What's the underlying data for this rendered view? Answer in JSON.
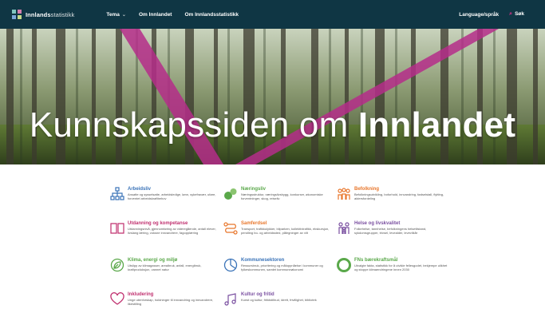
{
  "nav": {
    "logo_bold": "Innlands",
    "logo_light": "statistikk",
    "items": [
      {
        "label": "Tema",
        "has_dropdown": true
      },
      {
        "label": "Om Innlandet",
        "has_dropdown": false
      },
      {
        "label": "Om Innlandsstatistikk",
        "has_dropdown": false
      }
    ],
    "language": "Language/språk",
    "search": "Søk"
  },
  "hero": {
    "title_regular": "Kunnskapssiden om",
    "title_bold": "Innlandet"
  },
  "topics": [
    {
      "title": "Arbeidsliv",
      "desc": "Ansatte og sysselsatte, arbeidsledige, lønn, sykefravær, uføre, forventet arbeidskraftbehov",
      "color": "#3a73b8",
      "icon": "org-chart-icon"
    },
    {
      "title": "Næringsliv",
      "desc": "Næringsstruktur, næringslivsbygg, konkurser, økonomiske forventninger, skog, reiseliv",
      "color": "#5aa84a",
      "icon": "bubbles-icon"
    },
    {
      "title": "Befolkning",
      "desc": "Befolkningsutvikling, boforhold, innvandring, fødselstall, flytting, aldersfordeling",
      "color": "#e8762b",
      "icon": "people-icon"
    },
    {
      "title": "Utdanning og kompetanse",
      "desc": "Utdanningsnivå, gjennomføring av videregående, antall elever, livslang læring, voksne innvandrere, fagopplæring",
      "color": "#c0306f",
      "icon": "book-icon"
    },
    {
      "title": "Samferdsel",
      "desc": "Transport, trafikkulykker, bilparken, kollektivtrafikk, ekskursjon, pendling bo- og arbeidssted, pålegninger av vilt",
      "color": "#e8762b",
      "icon": "route-icon"
    },
    {
      "title": "Helse og livskvalitet",
      "desc": "Folkehelse, tannhelse, befolkningens helsetilstand, sykdomsgrupper, trivsel, levealder, levevilkår",
      "color": "#7a4fa0",
      "icon": "family-icon"
    },
    {
      "title": "Klima, energi og miljø",
      "desc": "Utslipp av klimagasser, arealbruk, avfall, energibruk, kraftproduksjon, vannet natur",
      "color": "#5aa84a",
      "icon": "leaf-icon"
    },
    {
      "title": "Kommunesektoren",
      "desc": "Ressursbruk, prioritering og måloppnåelse i kommuner og fylkeskommunen, samlet kommuneøkonomi",
      "color": "#3a73b8",
      "icon": "pie-icon"
    },
    {
      "title": "FNs bærekraftsmål",
      "desc": "Utvalgte fakta, statistikk for å utvikle fellesgodet, bekjempe ulikhet og stoppe klimaendringene innen 2030",
      "color": "#5aa84a",
      "icon": "circle-icon"
    },
    {
      "title": "Inkludering",
      "desc": "Unge utenforskap, holdninger til innvandring og innvandrere, likestilling",
      "color": "#c0306f",
      "icon": "heart-icon"
    },
    {
      "title": "Kultur og fritid",
      "desc": "Kunst og kultur, fritidstilbud, idrett, frivillighet, bibliotek",
      "color": "#7a4fa0",
      "icon": "music-icon"
    }
  ]
}
